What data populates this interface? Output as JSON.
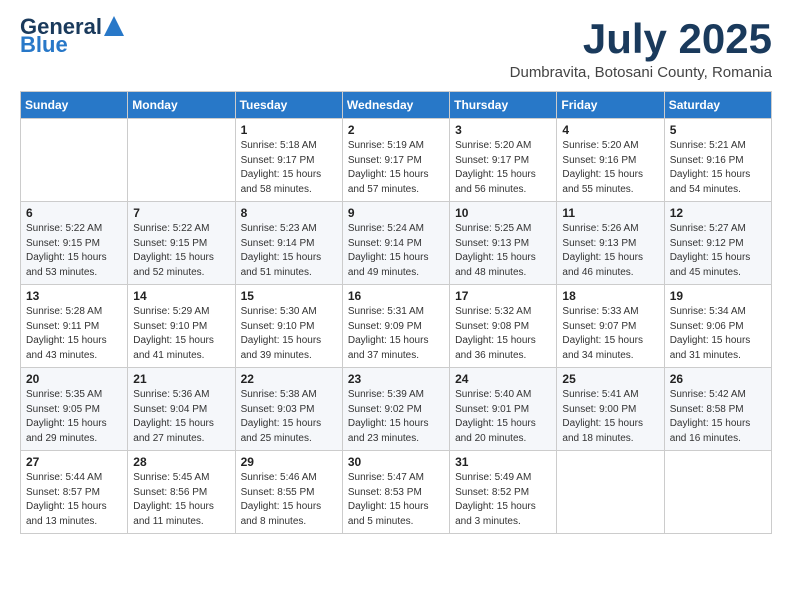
{
  "header": {
    "logo_line1": "General",
    "logo_line2": "Blue",
    "month_title": "July 2025",
    "location": "Dumbravita, Botosani County, Romania"
  },
  "weekdays": [
    "Sunday",
    "Monday",
    "Tuesday",
    "Wednesday",
    "Thursday",
    "Friday",
    "Saturday"
  ],
  "weeks": [
    [
      {
        "day": "",
        "info": ""
      },
      {
        "day": "",
        "info": ""
      },
      {
        "day": "1",
        "info": "Sunrise: 5:18 AM\nSunset: 9:17 PM\nDaylight: 15 hours and 58 minutes."
      },
      {
        "day": "2",
        "info": "Sunrise: 5:19 AM\nSunset: 9:17 PM\nDaylight: 15 hours and 57 minutes."
      },
      {
        "day": "3",
        "info": "Sunrise: 5:20 AM\nSunset: 9:17 PM\nDaylight: 15 hours and 56 minutes."
      },
      {
        "day": "4",
        "info": "Sunrise: 5:20 AM\nSunset: 9:16 PM\nDaylight: 15 hours and 55 minutes."
      },
      {
        "day": "5",
        "info": "Sunrise: 5:21 AM\nSunset: 9:16 PM\nDaylight: 15 hours and 54 minutes."
      }
    ],
    [
      {
        "day": "6",
        "info": "Sunrise: 5:22 AM\nSunset: 9:15 PM\nDaylight: 15 hours and 53 minutes."
      },
      {
        "day": "7",
        "info": "Sunrise: 5:22 AM\nSunset: 9:15 PM\nDaylight: 15 hours and 52 minutes."
      },
      {
        "day": "8",
        "info": "Sunrise: 5:23 AM\nSunset: 9:14 PM\nDaylight: 15 hours and 51 minutes."
      },
      {
        "day": "9",
        "info": "Sunrise: 5:24 AM\nSunset: 9:14 PM\nDaylight: 15 hours and 49 minutes."
      },
      {
        "day": "10",
        "info": "Sunrise: 5:25 AM\nSunset: 9:13 PM\nDaylight: 15 hours and 48 minutes."
      },
      {
        "day": "11",
        "info": "Sunrise: 5:26 AM\nSunset: 9:13 PM\nDaylight: 15 hours and 46 minutes."
      },
      {
        "day": "12",
        "info": "Sunrise: 5:27 AM\nSunset: 9:12 PM\nDaylight: 15 hours and 45 minutes."
      }
    ],
    [
      {
        "day": "13",
        "info": "Sunrise: 5:28 AM\nSunset: 9:11 PM\nDaylight: 15 hours and 43 minutes."
      },
      {
        "day": "14",
        "info": "Sunrise: 5:29 AM\nSunset: 9:10 PM\nDaylight: 15 hours and 41 minutes."
      },
      {
        "day": "15",
        "info": "Sunrise: 5:30 AM\nSunset: 9:10 PM\nDaylight: 15 hours and 39 minutes."
      },
      {
        "day": "16",
        "info": "Sunrise: 5:31 AM\nSunset: 9:09 PM\nDaylight: 15 hours and 37 minutes."
      },
      {
        "day": "17",
        "info": "Sunrise: 5:32 AM\nSunset: 9:08 PM\nDaylight: 15 hours and 36 minutes."
      },
      {
        "day": "18",
        "info": "Sunrise: 5:33 AM\nSunset: 9:07 PM\nDaylight: 15 hours and 34 minutes."
      },
      {
        "day": "19",
        "info": "Sunrise: 5:34 AM\nSunset: 9:06 PM\nDaylight: 15 hours and 31 minutes."
      }
    ],
    [
      {
        "day": "20",
        "info": "Sunrise: 5:35 AM\nSunset: 9:05 PM\nDaylight: 15 hours and 29 minutes."
      },
      {
        "day": "21",
        "info": "Sunrise: 5:36 AM\nSunset: 9:04 PM\nDaylight: 15 hours and 27 minutes."
      },
      {
        "day": "22",
        "info": "Sunrise: 5:38 AM\nSunset: 9:03 PM\nDaylight: 15 hours and 25 minutes."
      },
      {
        "day": "23",
        "info": "Sunrise: 5:39 AM\nSunset: 9:02 PM\nDaylight: 15 hours and 23 minutes."
      },
      {
        "day": "24",
        "info": "Sunrise: 5:40 AM\nSunset: 9:01 PM\nDaylight: 15 hours and 20 minutes."
      },
      {
        "day": "25",
        "info": "Sunrise: 5:41 AM\nSunset: 9:00 PM\nDaylight: 15 hours and 18 minutes."
      },
      {
        "day": "26",
        "info": "Sunrise: 5:42 AM\nSunset: 8:58 PM\nDaylight: 15 hours and 16 minutes."
      }
    ],
    [
      {
        "day": "27",
        "info": "Sunrise: 5:44 AM\nSunset: 8:57 PM\nDaylight: 15 hours and 13 minutes."
      },
      {
        "day": "28",
        "info": "Sunrise: 5:45 AM\nSunset: 8:56 PM\nDaylight: 15 hours and 11 minutes."
      },
      {
        "day": "29",
        "info": "Sunrise: 5:46 AM\nSunset: 8:55 PM\nDaylight: 15 hours and 8 minutes."
      },
      {
        "day": "30",
        "info": "Sunrise: 5:47 AM\nSunset: 8:53 PM\nDaylight: 15 hours and 5 minutes."
      },
      {
        "day": "31",
        "info": "Sunrise: 5:49 AM\nSunset: 8:52 PM\nDaylight: 15 hours and 3 minutes."
      },
      {
        "day": "",
        "info": ""
      },
      {
        "day": "",
        "info": ""
      }
    ]
  ]
}
